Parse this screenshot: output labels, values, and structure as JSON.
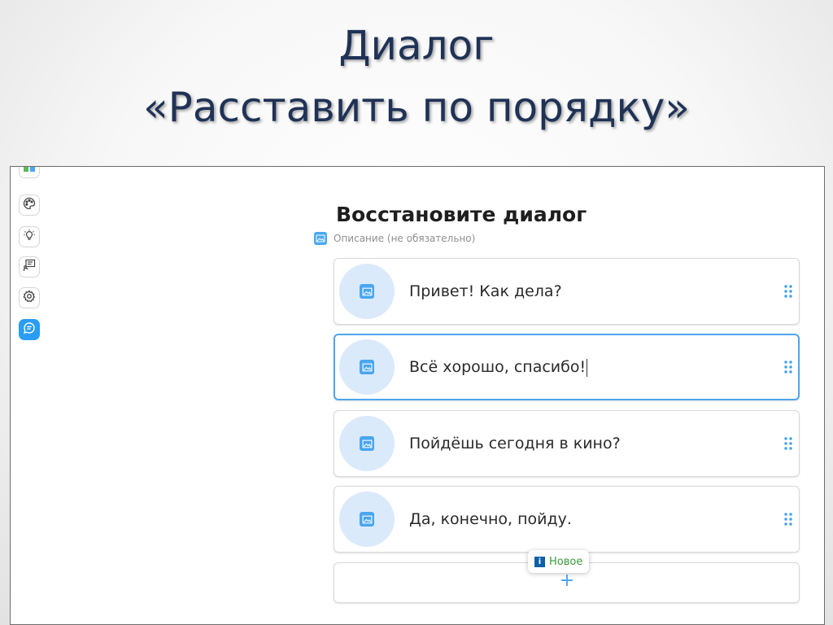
{
  "slide": {
    "title_line1": "Диалог",
    "title_line2": "«Расставить по порядку»"
  },
  "editor": {
    "heading": "Восстановите диалог",
    "description_placeholder": "Описание (не обязательно)",
    "items": [
      {
        "text": "Привет! Как дела?",
        "selected": false
      },
      {
        "text": "Всё хорошо, спасибо!",
        "selected": true
      },
      {
        "text": "Пойдёшь сегодня в кино?",
        "selected": false
      },
      {
        "text": "Да, конечно, пойду.",
        "selected": false
      }
    ],
    "add_button": "+",
    "new_tooltip": {
      "info_glyph": "i",
      "label": "Новое"
    }
  },
  "toolbar": {
    "icons": [
      "apps-icon",
      "palette-icon",
      "lightbulb-icon",
      "presentation-icon",
      "gear-icon",
      "chat-icon"
    ],
    "active": "chat-icon"
  },
  "colors": {
    "title": "#1f3256",
    "accent": "#2a9df4",
    "avatar_bg": "#dbeafb",
    "new_label": "#3a9b39",
    "info_badge": "#0d5fa8"
  }
}
